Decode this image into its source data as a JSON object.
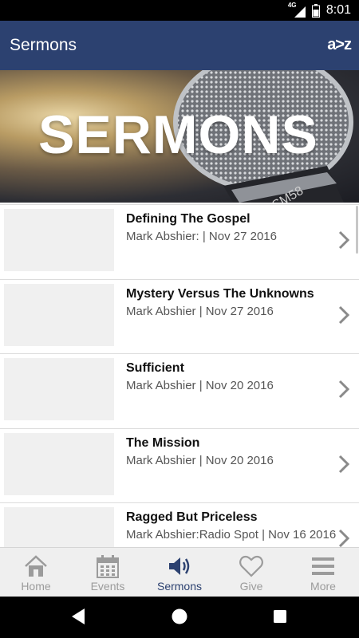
{
  "status": {
    "time": "8:01",
    "network": "4G"
  },
  "appbar": {
    "title": "Sermons",
    "sort_label": "a>z"
  },
  "banner": {
    "heading": "SERMONS",
    "mic_text": "SM58"
  },
  "sermons": [
    {
      "title": "Defining The Gospel",
      "subtitle": "Mark Abshier: | Nov 27 2016"
    },
    {
      "title": "Mystery Versus The Unknowns",
      "subtitle": "Mark Abshier | Nov 27 2016"
    },
    {
      "title": "Sufficient",
      "subtitle": "Mark Abshier | Nov 20 2016"
    },
    {
      "title": "The Mission",
      "subtitle": "Mark Abshier | Nov 20 2016"
    },
    {
      "title": "Ragged But Priceless",
      "subtitle": "Mark Abshier:Radio Spot | Nov 16 2016"
    }
  ],
  "tabs": [
    {
      "label": "Home",
      "icon": "home-icon",
      "active": false
    },
    {
      "label": "Events",
      "icon": "calendar-icon",
      "active": false
    },
    {
      "label": "Sermons",
      "icon": "speaker-icon",
      "active": true
    },
    {
      "label": "Give",
      "icon": "heart-icon",
      "active": false
    },
    {
      "label": "More",
      "icon": "menu-icon",
      "active": false
    }
  ],
  "colors": {
    "primary": "#2c4170",
    "inactive_tab": "#9b9b9b"
  }
}
